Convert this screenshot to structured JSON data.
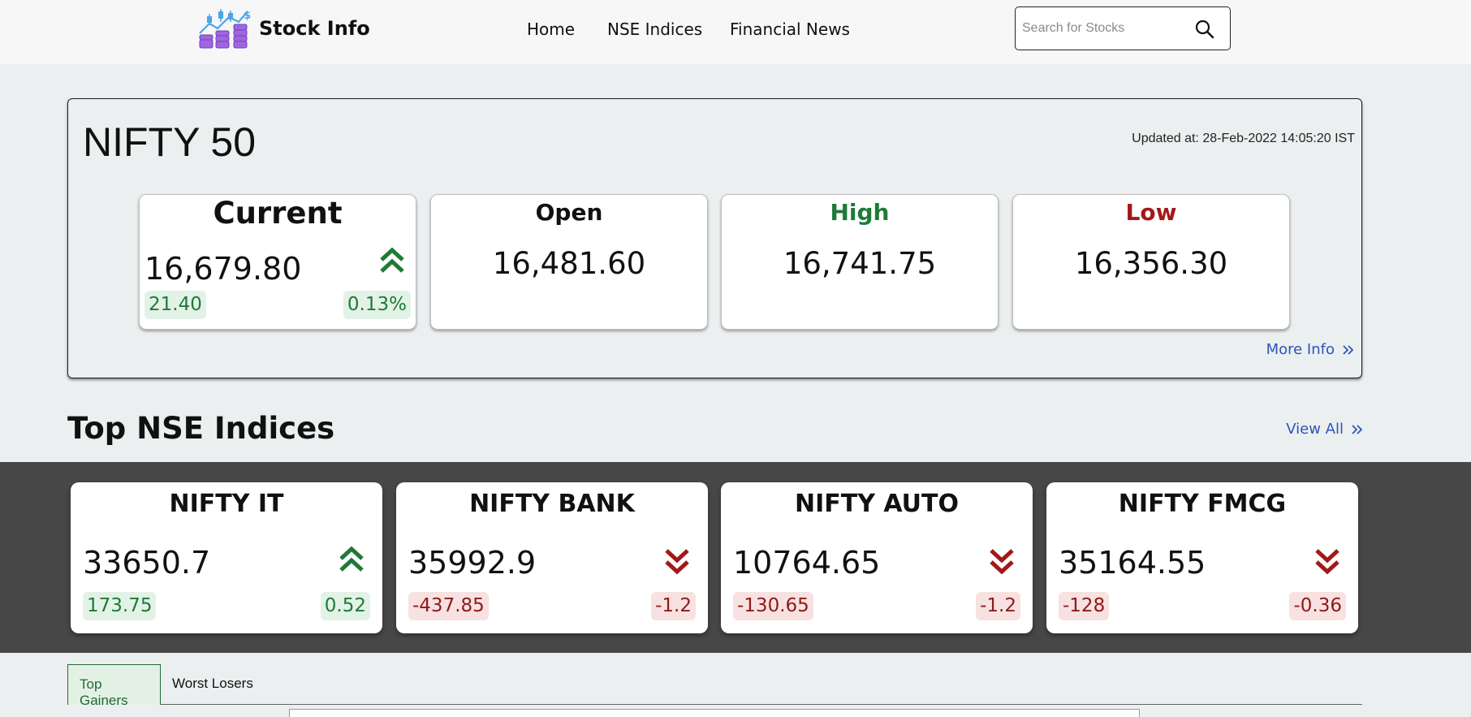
{
  "navbar": {
    "brand": "Stock Info",
    "links": [
      "Home",
      "NSE Indices",
      "Financial News"
    ],
    "search_placeholder": "Search for Stocks"
  },
  "main_index": {
    "title": "NIFTY 50",
    "updated": "Updated at: 28-Feb-2022 14:05:20 IST",
    "current": {
      "label": "Current",
      "value": "16,679.80",
      "change": "21.40",
      "percent": "0.13%",
      "trend": "up"
    },
    "open": {
      "label": "Open",
      "value": "16,481.60"
    },
    "high": {
      "label": "High",
      "value": "16,741.75"
    },
    "low": {
      "label": "Low",
      "value": "16,356.30"
    },
    "more_info": "More Info"
  },
  "top_indices": {
    "title": "Top NSE Indices",
    "view_all": "View All",
    "items": [
      {
        "name": "NIFTY IT",
        "value": "33650.7",
        "change": "173.75",
        "percent": "0.52",
        "trend": "up"
      },
      {
        "name": "NIFTY BANK",
        "value": "35992.9",
        "change": "-437.85",
        "percent": "-1.2",
        "trend": "down"
      },
      {
        "name": "NIFTY AUTO",
        "value": "10764.65",
        "change": "-130.65",
        "percent": "-1.2",
        "trend": "down"
      },
      {
        "name": "NIFTY FMCG",
        "value": "35164.55",
        "change": "-128",
        "percent": "-0.36",
        "trend": "down"
      }
    ]
  },
  "tabs": [
    "Top Gainers",
    "Worst Losers"
  ],
  "colors": {
    "up": "#1e7a36",
    "down": "#8e1a1a",
    "link": "#2c55b8",
    "high_label": "#1e7a36",
    "low_label": "#a31818"
  },
  "icons": {
    "logo": "stock-chart-coins-logo",
    "search": "search-icon",
    "up": "double-chevron-up-icon",
    "down": "double-chevron-down-icon",
    "link": "double-chevron-right-icon"
  }
}
